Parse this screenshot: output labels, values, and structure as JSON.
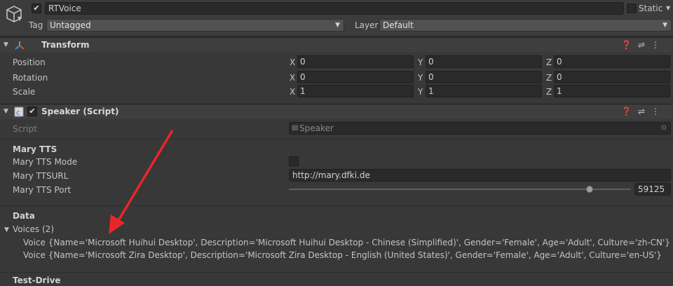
{
  "header": {
    "name_value": "RTVoice",
    "static_label": "Static",
    "tag_label": "Tag",
    "tag_value": "Untagged",
    "layer_label": "Layer",
    "layer_value": "Default"
  },
  "transform": {
    "title": "Transform",
    "rows": [
      {
        "label": "Position",
        "x": "0",
        "y": "0",
        "z": "0"
      },
      {
        "label": "Rotation",
        "x": "0",
        "y": "0",
        "z": "0"
      },
      {
        "label": "Scale",
        "x": "1",
        "y": "1",
        "z": "1"
      }
    ],
    "axis_x": "X",
    "axis_y": "Y",
    "axis_z": "Z"
  },
  "speaker": {
    "title": "Speaker (Script)",
    "script_label": "Script",
    "script_value": "Speaker",
    "mary_section": "Mary TTS",
    "mode_label": "Mary TTS Mode",
    "url_label": "Mary TTSURL",
    "url_value": "http://mary.dfki.de",
    "port_label": "Mary TTS Port",
    "port_value": "59125",
    "port_fraction": 0.88,
    "data_section": "Data",
    "voices_label": "Voices (2)",
    "voices": [
      "Voice {Name='Microsoft Huihui Desktop', Description='Microsoft Huihui Desktop - Chinese (Simplified)', Gender='Female', Age='Adult', Culture='zh-CN'}",
      "Voice {Name='Microsoft Zira Desktop', Description='Microsoft Zira Desktop - English (United States)', Gender='Female', Age='Adult', Culture='en-US'}"
    ],
    "test_section": "Test-Drive"
  },
  "colors": {
    "background": "#383838",
    "arrow": "#e8262a"
  }
}
